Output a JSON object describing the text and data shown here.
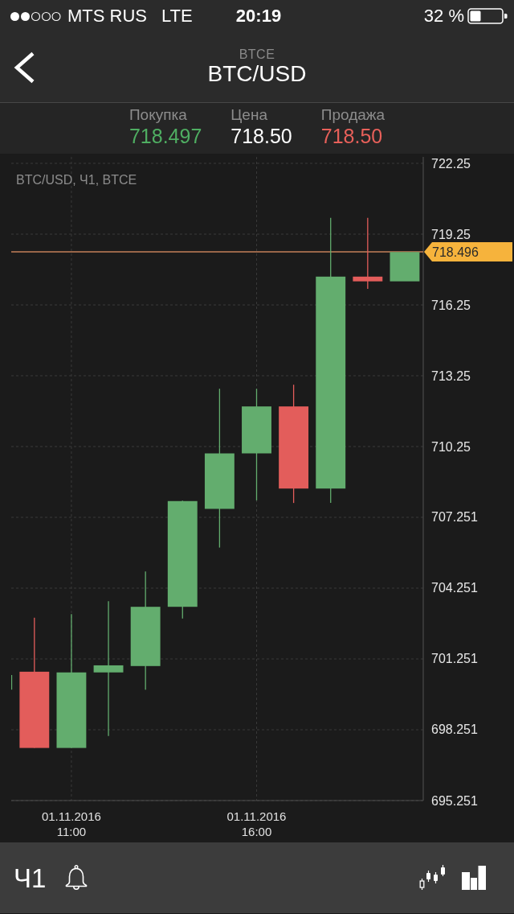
{
  "status_bar": {
    "carrier": "MTS RUS",
    "network": "LTE",
    "time": "20:19",
    "battery": "32 %"
  },
  "header": {
    "exchange": "BTCE",
    "pair": "BTC/USD"
  },
  "quotes": [
    {
      "label": "Покупка",
      "value": "718.497",
      "color": "#4fae62"
    },
    {
      "label": "Цена",
      "value": "718.50",
      "color": "#ffffff"
    },
    {
      "label": "Продажа",
      "value": "718.50",
      "color": "#e8605a"
    }
  ],
  "chart": {
    "chart_data": {
      "type": "candlestick",
      "title": "BTC/USD, Ч1, BTCE",
      "categories": [
        null,
        null,
        "01.11.2016\n11:00",
        null,
        null,
        null,
        null,
        "01.11.2016\n16:00",
        null,
        null,
        null,
        null
      ],
      "ylim": [
        695.251,
        722.25
      ],
      "yticks": [
        722.25,
        719.25,
        716.25,
        713.25,
        710.25,
        707.251,
        704.251,
        701.251,
        698.251,
        695.251
      ],
      "grid": true,
      "ohlc": [
        [
          699.95,
          700.57,
          699.95,
          700.57
        ],
        [
          700.71,
          703.0,
          697.48,
          697.48
        ],
        [
          697.48,
          703.15,
          697.48,
          700.68
        ],
        [
          700.68,
          703.7,
          697.99,
          700.98
        ],
        [
          700.95,
          704.96,
          699.95,
          703.46
        ],
        [
          703.46,
          707.96,
          702.96,
          707.94
        ],
        [
          707.61,
          712.7,
          705.97,
          709.96
        ],
        [
          709.96,
          712.7,
          707.97,
          711.95
        ],
        [
          711.95,
          712.87,
          707.86,
          708.47
        ],
        [
          708.47,
          719.94,
          707.86,
          717.45
        ],
        [
          717.45,
          719.94,
          716.93,
          717.25
        ],
        [
          717.25,
          718.49,
          717.25,
          718.49
        ]
      ],
      "ref_lines": [
        {
          "axis": "y",
          "value": 718.496,
          "label": "718.496"
        }
      ]
    }
  },
  "toolbar": {
    "timeframe": "Ч1"
  }
}
